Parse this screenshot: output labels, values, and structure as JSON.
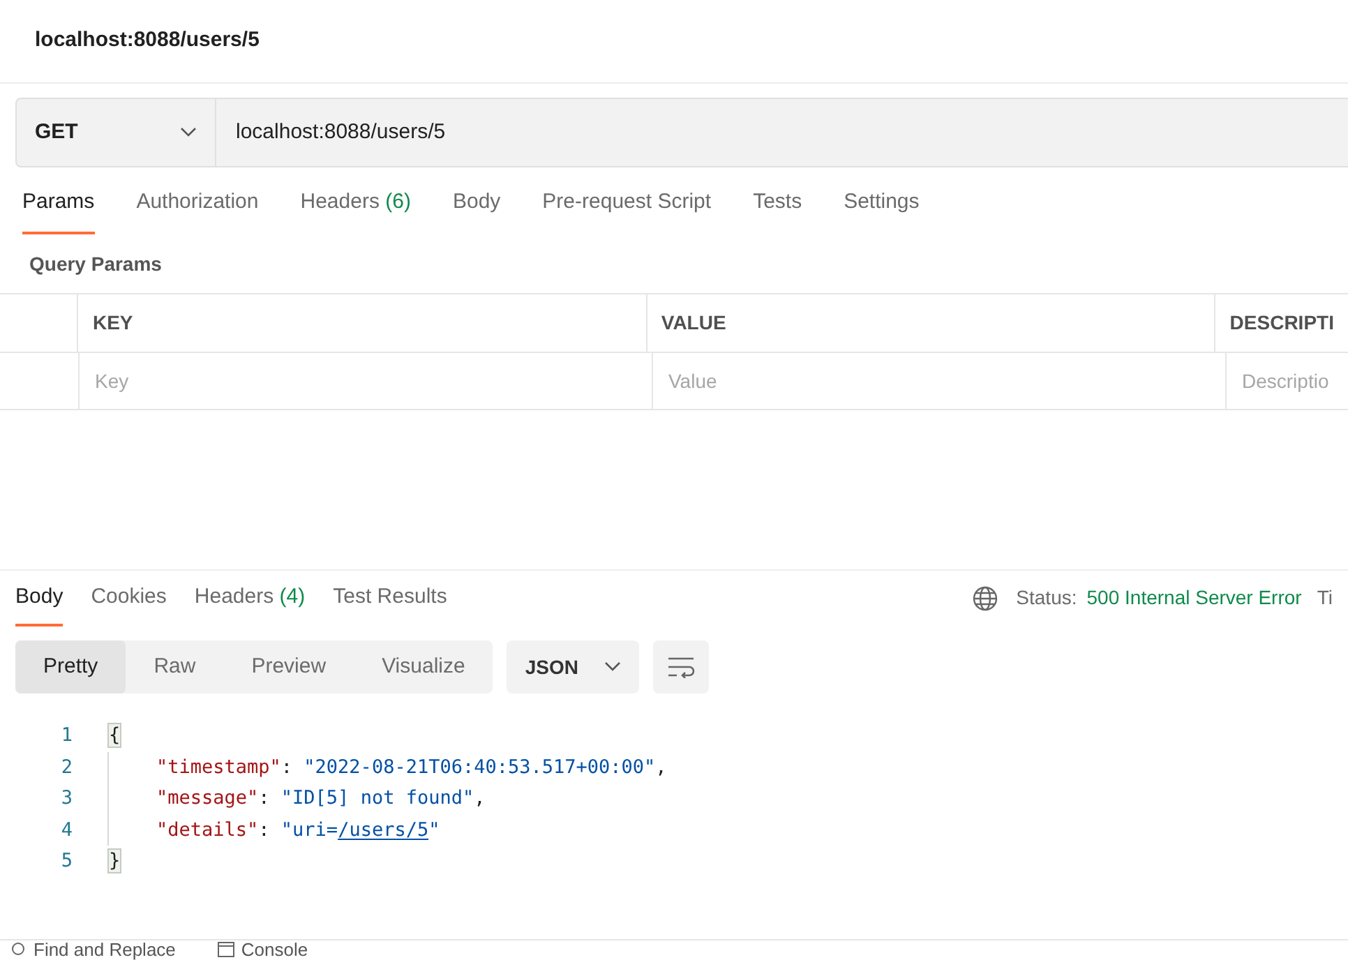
{
  "title": "localhost:8088/users/5",
  "request": {
    "method": "GET",
    "url": "localhost:8088/users/5"
  },
  "request_tabs": [
    {
      "label": "Params",
      "selected": true
    },
    {
      "label": "Authorization",
      "selected": false
    },
    {
      "label": "Headers",
      "count": "(6)",
      "selected": false
    },
    {
      "label": "Body",
      "selected": false
    },
    {
      "label": "Pre-request Script",
      "selected": false
    },
    {
      "label": "Tests",
      "selected": false
    },
    {
      "label": "Settings",
      "selected": false
    }
  ],
  "query_params": {
    "title": "Query Params",
    "columns": [
      "KEY",
      "VALUE",
      "DESCRIPTI"
    ],
    "placeholders": [
      "Key",
      "Value",
      "Descriptio"
    ]
  },
  "response_tabs": [
    {
      "label": "Body",
      "selected": true
    },
    {
      "label": "Cookies",
      "selected": false
    },
    {
      "label": "Headers",
      "count": "(4)",
      "selected": false
    },
    {
      "label": "Test Results",
      "selected": false
    }
  ],
  "status": {
    "label": "Status:",
    "value": "500 Internal Server Error",
    "next": "Ti"
  },
  "view_modes": [
    {
      "label": "Pretty",
      "selected": true
    },
    {
      "label": "Raw",
      "selected": false
    },
    {
      "label": "Preview",
      "selected": false
    },
    {
      "label": "Visualize",
      "selected": false
    }
  ],
  "format": "JSON",
  "code": [
    {
      "number": "1",
      "indented": false,
      "tokens": [
        {
          "kind": "brace",
          "text": "{"
        }
      ]
    },
    {
      "number": "2",
      "indented": true,
      "tokens": [
        {
          "kind": "key",
          "text": "\"timestamp\""
        },
        {
          "kind": "punct",
          "text": ": "
        },
        {
          "kind": "string",
          "text": "\"2022-08-21T06:40:53.517+00:00\""
        },
        {
          "kind": "punct",
          "text": ","
        }
      ]
    },
    {
      "number": "3",
      "indented": true,
      "tokens": [
        {
          "kind": "key",
          "text": "\"message\""
        },
        {
          "kind": "punct",
          "text": ": "
        },
        {
          "kind": "string",
          "text": "\"ID[5] not found\""
        },
        {
          "kind": "punct",
          "text": ","
        }
      ]
    },
    {
      "number": "4",
      "indented": true,
      "tokens": [
        {
          "kind": "key",
          "text": "\"details\""
        },
        {
          "kind": "punct",
          "text": ": "
        },
        {
          "kind": "string",
          "text": "\"uri="
        },
        {
          "kind": "link",
          "text": "/users/5"
        },
        {
          "kind": "string",
          "text": "\""
        }
      ]
    },
    {
      "number": "5",
      "indented": false,
      "tokens": [
        {
          "kind": "brace",
          "text": "}"
        }
      ]
    }
  ],
  "footer": [
    "Find and Replace",
    "Console"
  ]
}
